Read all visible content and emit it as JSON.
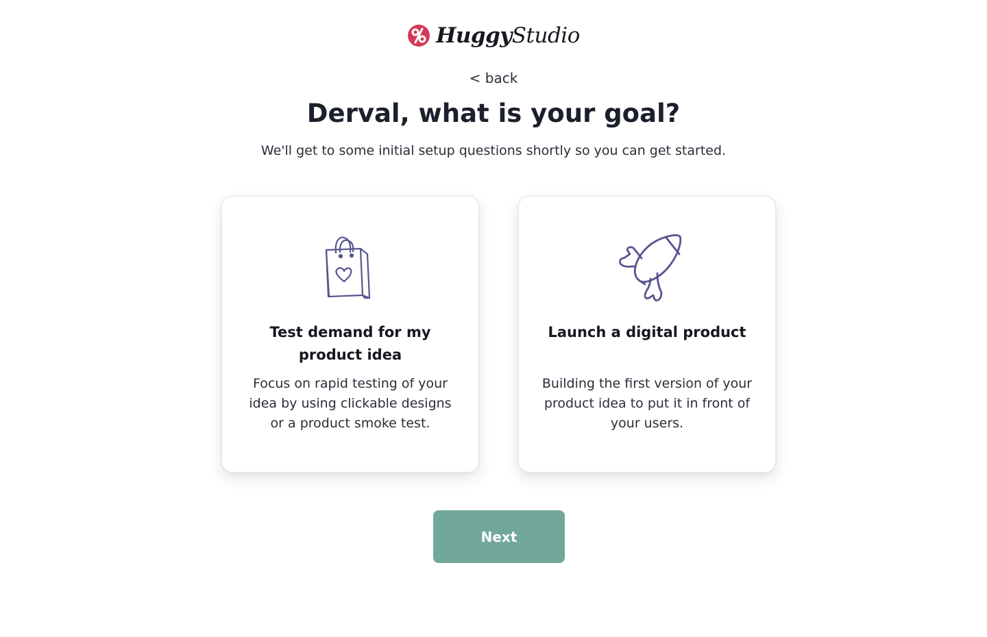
{
  "brand": {
    "logo_icon": "percent-circle-logo-icon",
    "name_part1": "Huggy",
    "name_part2": "Studio",
    "color": "#d33a58"
  },
  "nav": {
    "back_label": "< back"
  },
  "header": {
    "title": "Derval, what is your goal?",
    "subtitle": "We'll get to some initial setup questions shortly so you can get started."
  },
  "options": [
    {
      "icon": "shopping-bag-heart-icon",
      "title": "Test demand for my product idea",
      "description": "Focus on rapid testing of your idea by using clickable designs or a product smoke test."
    },
    {
      "icon": "rocket-icon",
      "title": "Launch a digital product",
      "description": "Building the first version of your product idea to put it in front of your users."
    }
  ],
  "actions": {
    "next_label": "Next"
  },
  "colors": {
    "accent_button": "#71a89b",
    "icon_stroke": "#56548f",
    "text_dark": "#1c1f2c"
  }
}
